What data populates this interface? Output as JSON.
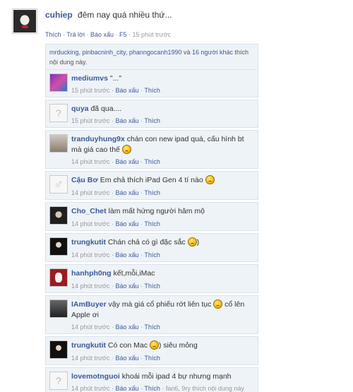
{
  "post": {
    "author": "cuhiep",
    "text": "đêm nay quá nhiều thứ...",
    "actions": {
      "like": "Thích",
      "reply": "Trả lời",
      "report": "Báo xấu",
      "f5": "F5",
      "time": "15 phút trước"
    }
  },
  "likes": {
    "names": "mrducking, pinbacninh_city, phanngocanh1990",
    "and": "và",
    "others": "16 người khác",
    "suffix": "thích nội dung này."
  },
  "comments": [
    {
      "author": "mediumvs",
      "text": "\"...\"",
      "time": "15 phút trước",
      "avatar": "purple-icon",
      "emoticon": false
    },
    {
      "author": "quya",
      "text": "đã qua....",
      "time": "15 phút trước",
      "avatar": "placeholder-icon",
      "emoticon": false
    },
    {
      "author": "tranduyhung9x",
      "text": "chán con new ipad quá, cấu hình bt mà giá cao thế",
      "time": "14 phút trước",
      "avatar": "person-icon",
      "emoticon": true
    },
    {
      "author": "Cậu Bơ",
      "text": "Em chả thích iPad Gen 4 tí nào",
      "time": "14 phút trước",
      "avatar": "male-icon",
      "emoticon": true
    },
    {
      "author": "Cho_Chet",
      "text": "làm mất hứng người hâm mộ",
      "time": "14 phút trước",
      "avatar": "dark-icon",
      "emoticon": false
    },
    {
      "author": "trungkutit",
      "text": "Chán chả có gì đặc sắc",
      "text_after": ")",
      "time": "14 phút trước",
      "avatar": "dark2-icon",
      "emoticon": true
    },
    {
      "author": "hanhph0ng",
      "text": "kết,mỗi,iMac",
      "time": "14 phút trước",
      "avatar": "red-icon",
      "emoticon": false
    },
    {
      "author": "IAmBuyer",
      "text": "vậy mà giá cổ phiếu rớt liên tục",
      "text_after": "cổ lên Apple ơi",
      "time": "14 phút trước",
      "avatar": "street-icon",
      "emoticon": true
    },
    {
      "author": "trungkutit",
      "text": "Có con Mac",
      "text_after": ") siêu mỏng",
      "time": "14 phút trước",
      "avatar": "dark2-icon",
      "emoticon": true
    },
    {
      "author": "lovemotnguoi",
      "text": "khoái mỗi ipad 4 bự nhưng mạnh",
      "time": "14 phút trước",
      "avatar": "placeholder-icon",
      "emoticon": false,
      "extra": "fan6, 9ry thích nội dung này"
    }
  ],
  "labels": {
    "report": "Báo xấu",
    "like": "Thích",
    "dot": "·"
  }
}
